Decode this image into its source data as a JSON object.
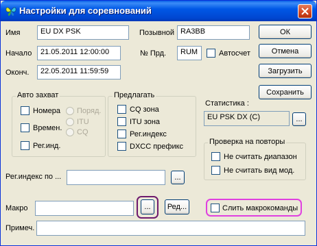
{
  "window": {
    "title": "Настройки для соревнований"
  },
  "fields": {
    "name": {
      "label": "Имя",
      "value": "EU DX PSK"
    },
    "start": {
      "label": "Начало",
      "value": "21.05.2011 12:00:00"
    },
    "end": {
      "label": "Оконч.",
      "value": "22.05.2011 11:59:59"
    },
    "callsign": {
      "label": "Позывной",
      "value": "RA3BB"
    },
    "number": {
      "label": "№ Прд.",
      "value": "RUM"
    },
    "autocount": {
      "label": "Автосчет"
    }
  },
  "buttons": {
    "ok": "ОК",
    "cancel": "Отмена",
    "load": "Загрузить",
    "save": "Сохранить",
    "browse": "...",
    "edit": "Ред..."
  },
  "auto_capture": {
    "title": "Авто захват",
    "checkboxes": [
      "Номера",
      "Времен.",
      "Рег.инд."
    ],
    "radios": [
      "Поряд.",
      "ITU",
      "CQ"
    ]
  },
  "offer": {
    "title": "Предлагать",
    "items": [
      "CQ зона",
      "ITU зона",
      "Рег.индекс",
      "DXCC префикс"
    ]
  },
  "statistics": {
    "label": "Статистика :",
    "value": "EU PSK DX (C)"
  },
  "dupe_check": {
    "title": "Проверка на повторы",
    "items": [
      "Не считать диапазон",
      "Не считать вид мод."
    ]
  },
  "region_index": {
    "label": "Рег.индекс по ...",
    "value": ""
  },
  "macro": {
    "label": "Макро",
    "value": "",
    "merge_label": "Слить макрокоманды"
  },
  "note": {
    "label": "Примеч.",
    "value": ""
  },
  "colors": {
    "titlebar": "#0058e6",
    "highlight_macro": "#6e1a6e",
    "highlight_merge": "#e040e0"
  }
}
